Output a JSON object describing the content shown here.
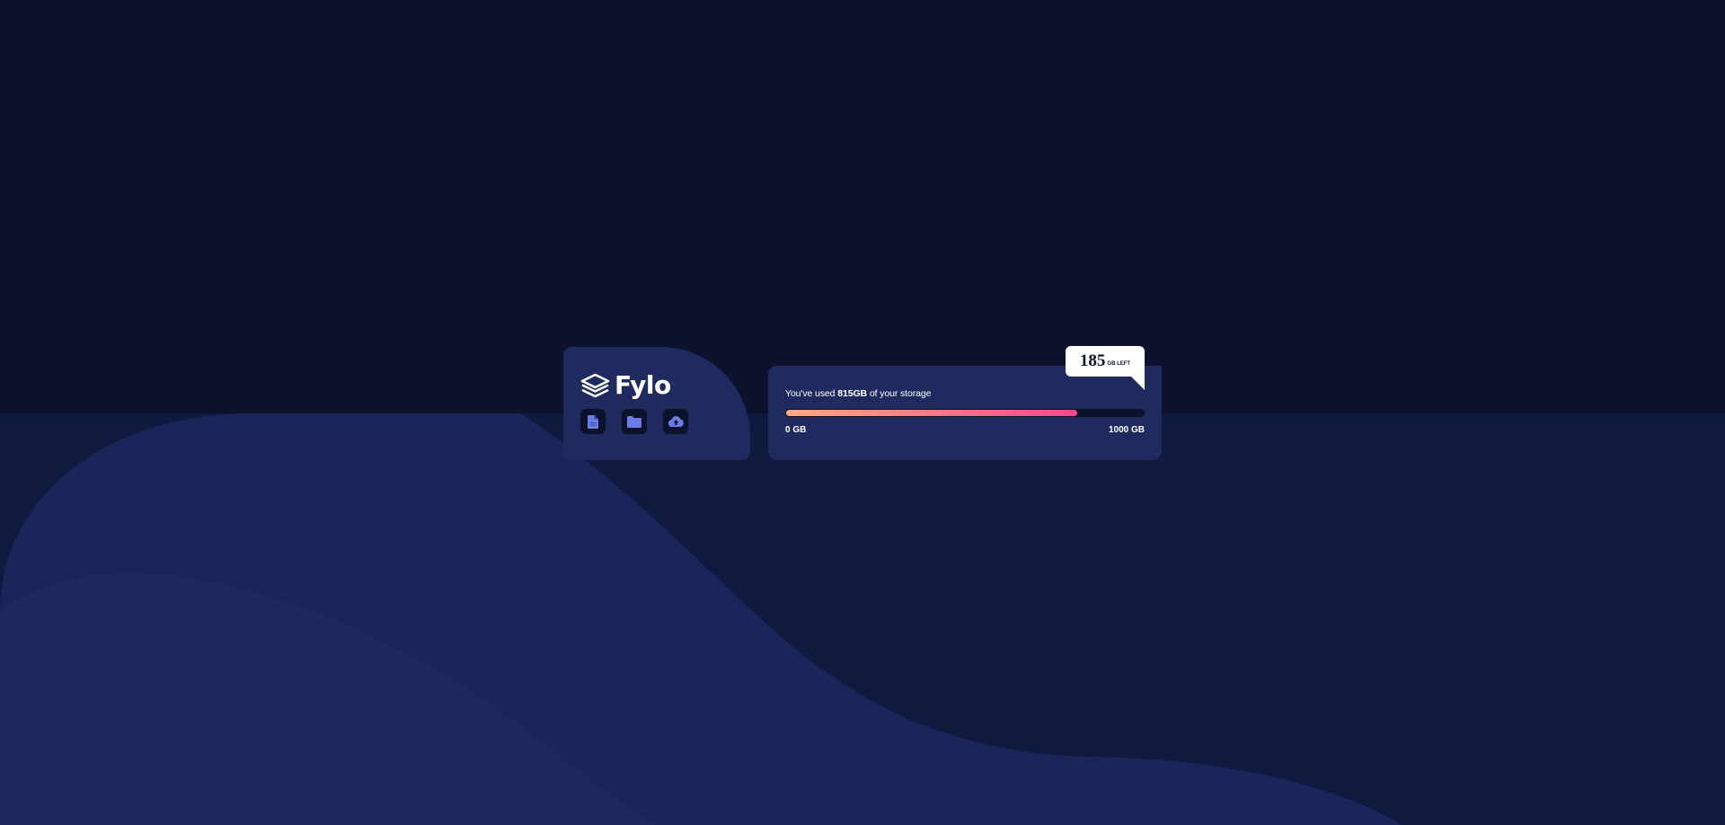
{
  "brand": {
    "name": "Fylo"
  },
  "toolbar": {
    "icons": [
      "document-icon",
      "folder-icon",
      "upload-icon"
    ]
  },
  "storage": {
    "usage_prefix": "You've used ",
    "used_amount": "815GB",
    "usage_suffix": " of your storage",
    "min_label": "0 GB",
    "max_label": "1000 GB",
    "used_fraction": 0.815
  },
  "remaining": {
    "amount": "185",
    "unit": "GB LEFT"
  },
  "colors": {
    "background": "#0c122c",
    "card": "#1f2b5f",
    "progress_start": "#ffa985",
    "progress_end": "#f5498d",
    "icon": "#6a7ce6"
  }
}
